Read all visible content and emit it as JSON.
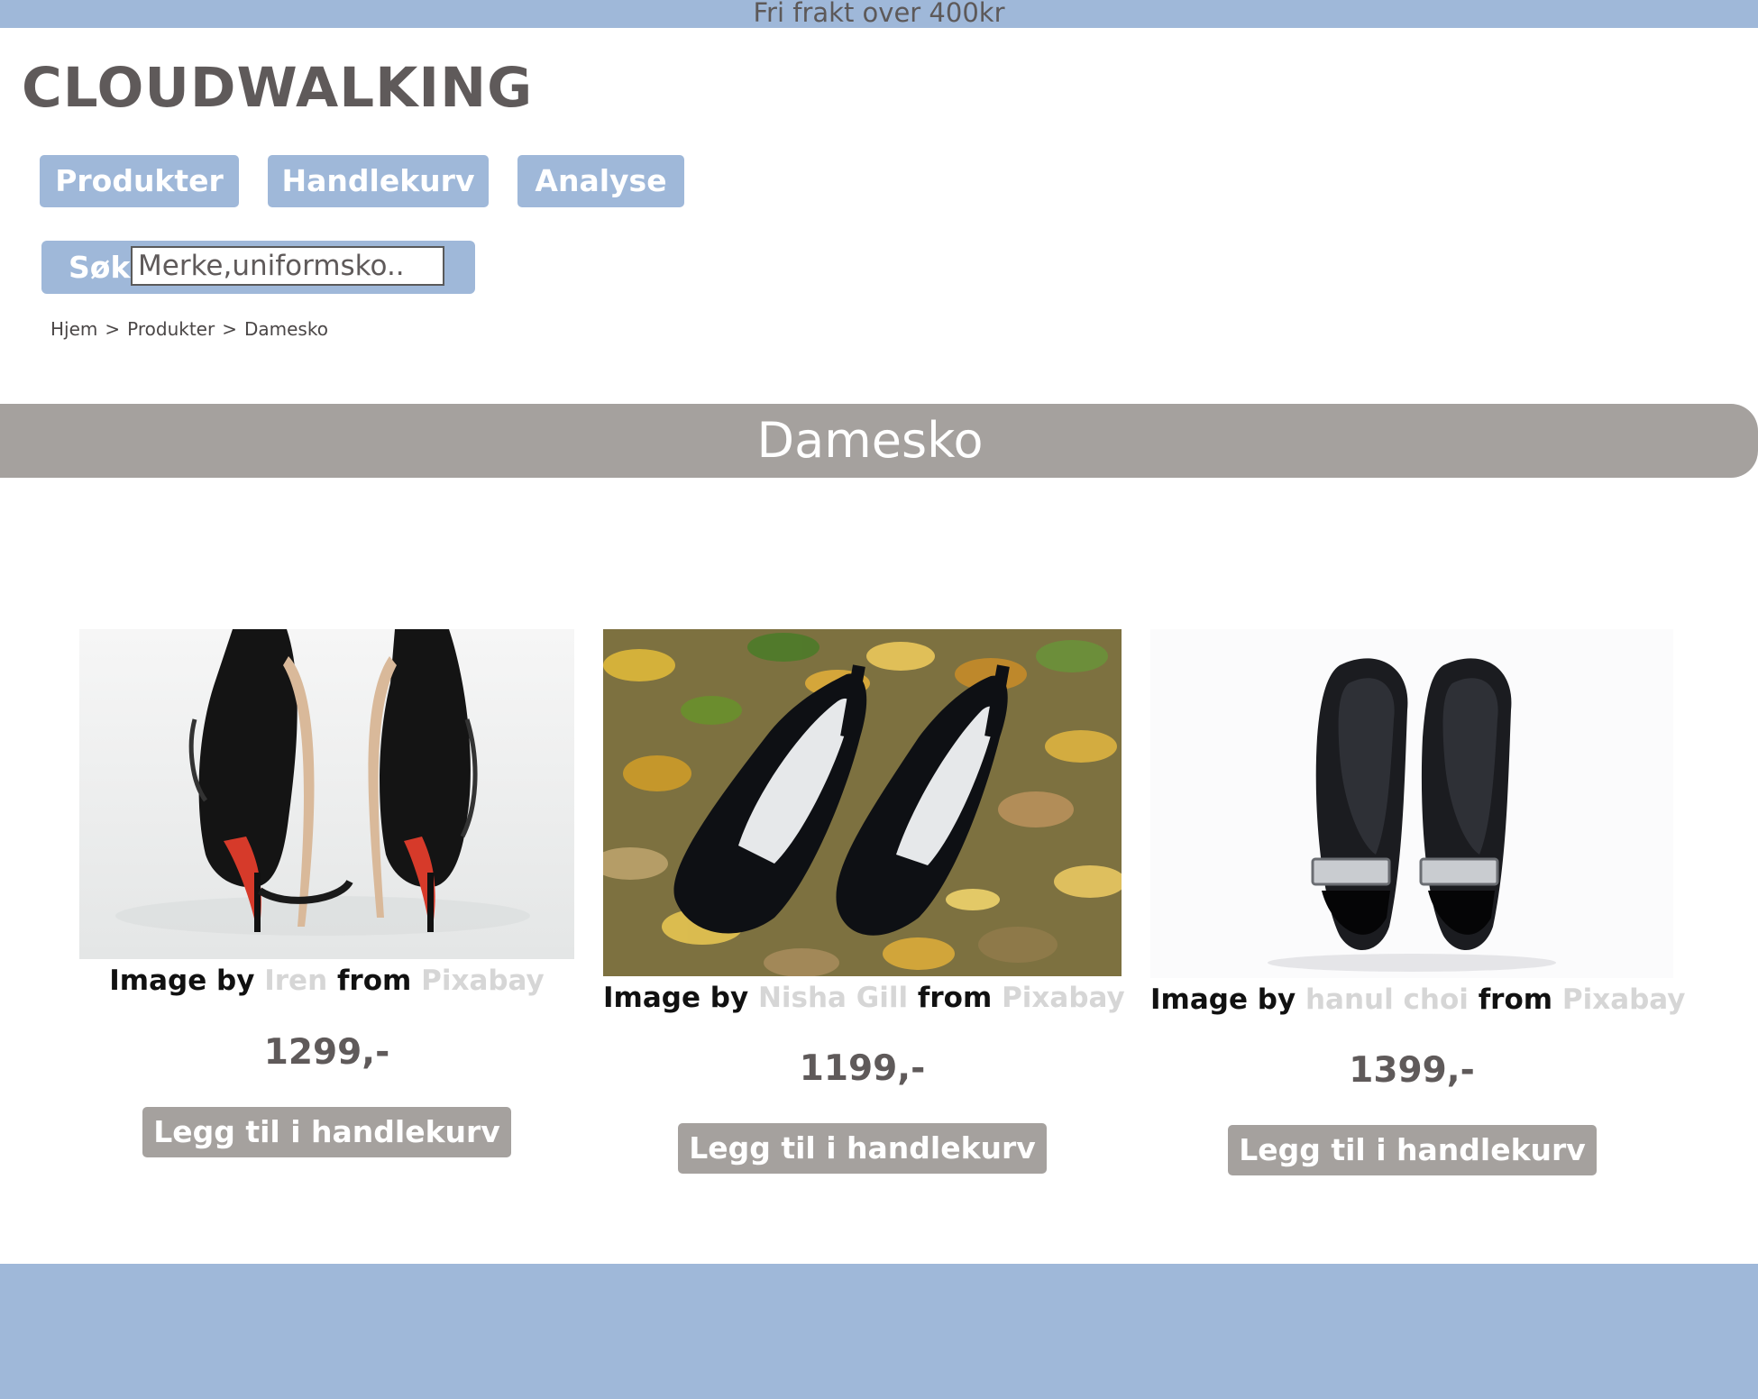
{
  "announcement": "Fri frakt over 400kr",
  "brand": "CLOUDWALKING",
  "nav": {
    "products": "Produkter",
    "cart": "Handlekurv",
    "analysis": "Analyse"
  },
  "search": {
    "label": "Søk",
    "placeholder": "Merke,uniformsko.."
  },
  "breadcrumb": {
    "home": "Hjem",
    "products": "Produkter",
    "current": "Damesko",
    "separator": ">"
  },
  "category_title": "Damesko",
  "products": [
    {
      "credit_prefix": "Image by",
      "photographer": "Iren",
      "credit_middle": "from",
      "source": "Pixabay",
      "price": "1299,-",
      "add_label": "Legg til i handlekurv",
      "image_icon": "high-heel-sandals-photo"
    },
    {
      "credit_prefix": "Image by",
      "photographer": "Nisha Gill",
      "credit_middle": "from",
      "source": "Pixabay",
      "price": "1199,-",
      "add_label": "Legg til i handlekurv",
      "image_icon": "black-pumps-in-leaves-photo"
    },
    {
      "credit_prefix": "Image by",
      "photographer": "hanul choi",
      "credit_middle": "from",
      "source": "Pixabay",
      "price": "1399,-",
      "add_label": "Legg til i handlekurv",
      "image_icon": "patent-pumps-photo"
    }
  ],
  "colors": {
    "accent_blue": "#9fb8d9",
    "banner_gray": "#a5a19e",
    "text_dark": "#5f5a5a"
  }
}
